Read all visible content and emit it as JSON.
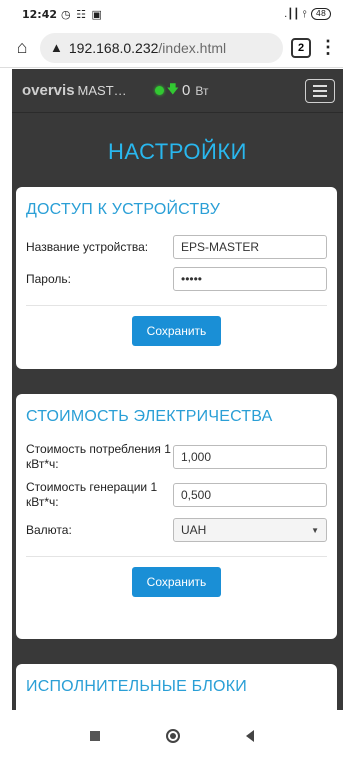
{
  "statusbar": {
    "time": "12:42",
    "icons": "◷ ☷ ▣",
    "signal": ".┃┃ ⫯",
    "battery": "48"
  },
  "browser": {
    "host": "192.168.0.232",
    "path": "/index.html",
    "tab_count": "2"
  },
  "nav": {
    "brand_logo": "overvis",
    "brand_name": "MAST…",
    "power_value": "0",
    "power_unit": "Вт"
  },
  "page": {
    "title": "НАСТРОЙКИ"
  },
  "access": {
    "title": "ДОСТУП К УСТРОЙСТВУ",
    "device_name_label": "Название устройства:",
    "device_name_value": "EPS-MASTER",
    "password_label": "Пароль:",
    "password_value": "•••••",
    "save_label": "Сохранить"
  },
  "cost": {
    "title": "СТОИМОСТЬ ЭЛЕКТРИЧЕСТВА",
    "consumption_label": "Стоимость потребления 1 кВт*ч:",
    "consumption_value": "1,000",
    "generation_label": "Стоимость генерации 1 кВт*ч:",
    "generation_value": "0,500",
    "currency_label": "Валюта:",
    "currency_value": "UAH",
    "save_label": "Сохранить"
  },
  "actuators": {
    "title": "ИСПОЛНИТЕЛЬНЫЕ БЛОКИ"
  },
  "colors": {
    "accent": "#2a9fd6",
    "button": "#1a8fd6",
    "background": "#393939",
    "status_ok": "#32c832"
  }
}
